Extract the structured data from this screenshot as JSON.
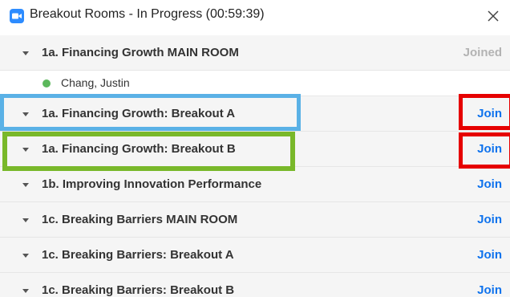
{
  "window": {
    "title": "Breakout Rooms - In Progress (00:59:39)",
    "app_icon": "zoom-camera-icon",
    "close_icon": "close-icon"
  },
  "colors": {
    "accent": "#0e72ed",
    "joined": "#b3b3b3",
    "online_dot": "#5cb85c",
    "highlight_blue": "#5ab1e6",
    "highlight_green": "#79b82a",
    "highlight_red": "#e60000"
  },
  "rooms": [
    {
      "name": "1a. Financing Growth MAIN ROOM",
      "action": "Joined"
    },
    {
      "name": "1a. Financing Growth: Breakout A",
      "action": "Join"
    },
    {
      "name": "1a. Financing Growth: Breakout B",
      "action": "Join"
    },
    {
      "name": "1b. Improving Innovation Performance",
      "action": "Join"
    },
    {
      "name": "1c. Breaking Barriers MAIN ROOM",
      "action": "Join"
    },
    {
      "name": "1c. Breaking Barriers: Breakout A",
      "action": "Join"
    },
    {
      "name": "1c. Breaking Barriers: Breakout B",
      "action": "Join"
    }
  ],
  "participants": [
    {
      "name": "Chang, Justin",
      "status": "online"
    }
  ]
}
